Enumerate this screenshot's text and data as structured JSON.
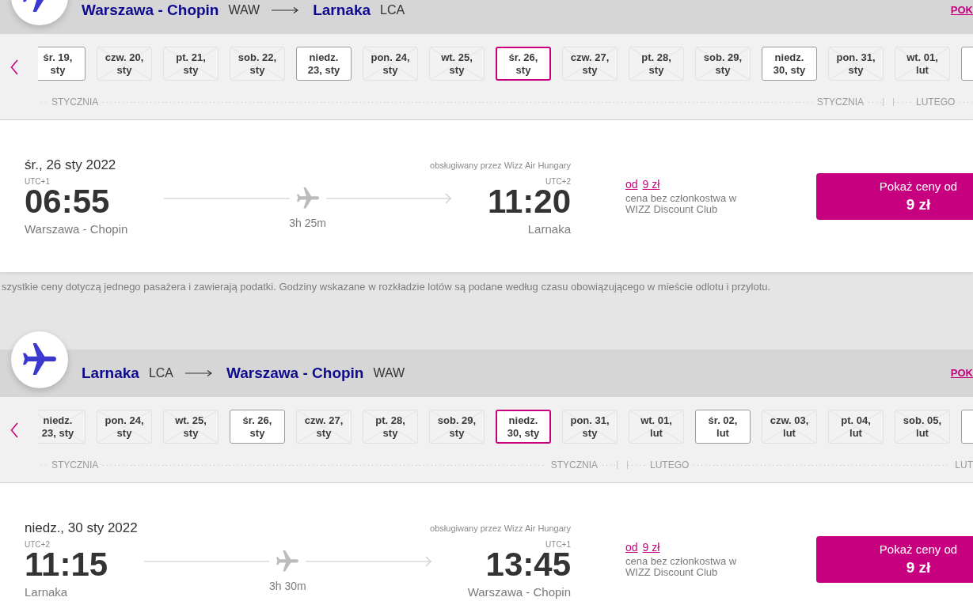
{
  "sections": [
    {
      "header": {
        "origin_city": "Warszawa - Chopin",
        "origin_code": "WAW",
        "destination_city": "Larnaka",
        "destination_code": "LCA",
        "link": "POK"
      },
      "date_strip": {
        "months": [
          {
            "labels": [
              "STYCZNIA",
              "STYCZNIA"
            ],
            "dates": [
              {
                "label": "śr. 19, sty",
                "available": true,
                "selected": false
              },
              {
                "label": "czw. 20, sty",
                "available": false,
                "selected": false
              },
              {
                "label": "pt. 21, sty",
                "available": false,
                "selected": false
              },
              {
                "label": "sob. 22, sty",
                "available": false,
                "selected": false
              },
              {
                "label": "niedz. 23, sty",
                "available": true,
                "selected": false
              },
              {
                "label": "pon. 24, sty",
                "available": false,
                "selected": false
              },
              {
                "label": "wt. 25, sty",
                "available": false,
                "selected": false
              },
              {
                "label": "śr. 26, sty",
                "available": true,
                "selected": true
              },
              {
                "label": "czw. 27, sty",
                "available": false,
                "selected": false
              },
              {
                "label": "pt. 28, sty",
                "available": false,
                "selected": false
              },
              {
                "label": "sob. 29, sty",
                "available": false,
                "selected": false
              },
              {
                "label": "niedz. 30, sty",
                "available": true,
                "selected": false
              },
              {
                "label": "pon. 31, sty",
                "available": false,
                "selected": false
              }
            ]
          },
          {
            "labels": [
              "LUTEGO"
            ],
            "dates": [
              {
                "label": "wt. 01, lut",
                "available": false,
                "selected": false
              },
              {
                "available": true,
                "selected": false
              }
            ]
          }
        ]
      },
      "flight": {
        "date": "śr., 26 sty 2022",
        "operator": "obsługiwany przez Wizz Air Hungary",
        "departure": {
          "utc": "UTC+1",
          "time": "06:55",
          "city": "Warszawa - Chopin"
        },
        "duration": "3h 25m",
        "arrival": {
          "utc": "UTC+2",
          "time": "11:20",
          "city": "Larnaka"
        },
        "price": {
          "prefix": "od",
          "amount": "9 zł",
          "note": "cena bez członkostwa w WIZZ Discount Club"
        },
        "button": {
          "label": "Pokaż ceny od",
          "price": "9 zł"
        }
      },
      "note": "szystkie ceny dotyczą jednego pasażera i zawierają podatki. Godziny wskazane w rozkładzie lotów są podane według czasu obowiązującego w mieście odlotu i przylotu."
    },
    {
      "header": {
        "origin_city": "Larnaka",
        "origin_code": "LCA",
        "destination_city": "Warszawa - Chopin",
        "destination_code": "WAW",
        "link": "POK"
      },
      "date_strip": {
        "months": [
          {
            "labels": [
              "STYCZNIA",
              "STYCZNIA"
            ],
            "dates": [
              {
                "label": "niedz. 23, sty",
                "available": false,
                "selected": false
              },
              {
                "label": "pon. 24, sty",
                "available": false,
                "selected": false
              },
              {
                "label": "wt. 25, sty",
                "available": false,
                "selected": false
              },
              {
                "label": "śr. 26, sty",
                "available": true,
                "selected": false
              },
              {
                "label": "czw. 27, sty",
                "available": false,
                "selected": false
              },
              {
                "label": "pt. 28, sty",
                "available": false,
                "selected": false
              },
              {
                "label": "sob. 29, sty",
                "available": false,
                "selected": false
              },
              {
                "label": "niedz. 30, sty",
                "available": true,
                "selected": true
              },
              {
                "label": "pon. 31, sty",
                "available": false,
                "selected": false
              }
            ]
          },
          {
            "labels": [
              "LUTEGO",
              "LUT"
            ],
            "dates": [
              {
                "label": "wt. 01, lut",
                "available": false,
                "selected": false
              },
              {
                "label": "śr. 02, lut",
                "available": true,
                "selected": false
              },
              {
                "label": "czw. 03, lut",
                "available": false,
                "selected": false
              },
              {
                "label": "pt. 04, lut",
                "available": false,
                "selected": false
              },
              {
                "label": "sob. 05, lut",
                "available": false,
                "selected": false
              },
              {
                "available": true,
                "selected": false
              }
            ]
          }
        ]
      },
      "flight": {
        "date": "niedz., 30 sty 2022",
        "operator": "obsługiwany przez Wizz Air Hungary",
        "departure": {
          "utc": "UTC+2",
          "time": "11:15",
          "city": "Larnaka"
        },
        "duration": "3h 30m",
        "arrival": {
          "utc": "UTC+1",
          "time": "13:45",
          "city": "Warszawa - Chopin"
        },
        "price": {
          "prefix": "od",
          "amount": "9 zł",
          "note": "cena bez członkostwa w WIZZ Discount Club"
        },
        "button": {
          "label": "Pokaż ceny od",
          "price": "9 zł"
        }
      }
    }
  ]
}
